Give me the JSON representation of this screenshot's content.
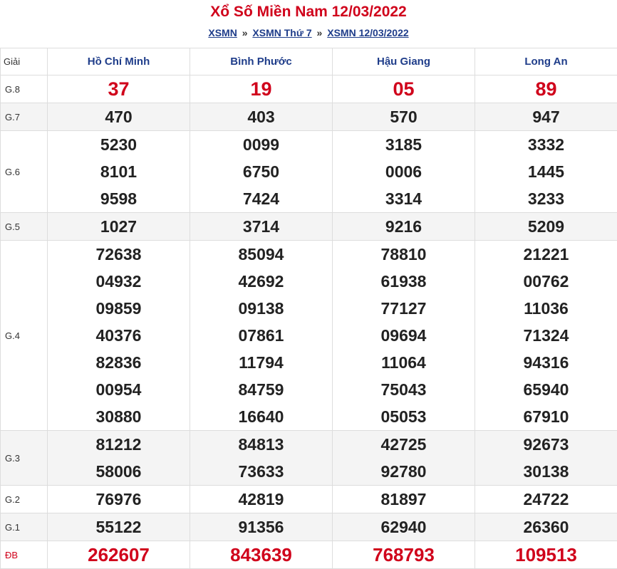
{
  "title": "Xổ Số Miền Nam 12/03/2022",
  "breadcrumb": {
    "link1": "XSMN",
    "sep1": "»",
    "link2": "XSMN Thứ 7",
    "sep2": "»",
    "link3": "XSMN 12/03/2022"
  },
  "table": {
    "header_label": "Giải",
    "provinces": [
      "Hồ Chí Minh",
      "Bình Phước",
      "Hậu Giang",
      "Long An"
    ],
    "colors": {
      "red": "#d0021b",
      "link_blue": "#1f3d8a"
    },
    "prizes": [
      {
        "label": "G.8",
        "style": "big",
        "alt": false,
        "values": [
          [
            "37"
          ],
          [
            "19"
          ],
          [
            "05"
          ],
          [
            "89"
          ]
        ]
      },
      {
        "label": "G.7",
        "style": "normal",
        "alt": true,
        "values": [
          [
            "470"
          ],
          [
            "403"
          ],
          [
            "570"
          ],
          [
            "947"
          ]
        ]
      },
      {
        "label": "G.6",
        "style": "normal",
        "alt": false,
        "values": [
          [
            "5230",
            "8101",
            "9598"
          ],
          [
            "0099",
            "6750",
            "7424"
          ],
          [
            "3185",
            "0006",
            "3314"
          ],
          [
            "3332",
            "1445",
            "3233"
          ]
        ]
      },
      {
        "label": "G.5",
        "style": "normal",
        "alt": true,
        "values": [
          [
            "1027"
          ],
          [
            "3714"
          ],
          [
            "9216"
          ],
          [
            "5209"
          ]
        ]
      },
      {
        "label": "G.4",
        "style": "normal",
        "alt": false,
        "values": [
          [
            "72638",
            "04932",
            "09859",
            "40376",
            "82836",
            "00954",
            "30880"
          ],
          [
            "85094",
            "42692",
            "09138",
            "07861",
            "11794",
            "84759",
            "16640"
          ],
          [
            "78810",
            "61938",
            "77127",
            "09694",
            "11064",
            "75043",
            "05053"
          ],
          [
            "21221",
            "00762",
            "11036",
            "71324",
            "94316",
            "65940",
            "67910"
          ]
        ]
      },
      {
        "label": "G.3",
        "style": "normal",
        "alt": true,
        "values": [
          [
            "81212",
            "58006"
          ],
          [
            "84813",
            "73633"
          ],
          [
            "42725",
            "92780"
          ],
          [
            "92673",
            "30138"
          ]
        ]
      },
      {
        "label": "G.2",
        "style": "normal",
        "alt": false,
        "values": [
          [
            "76976"
          ],
          [
            "42819"
          ],
          [
            "81897"
          ],
          [
            "24722"
          ]
        ]
      },
      {
        "label": "G.1",
        "style": "normal",
        "alt": true,
        "values": [
          [
            "55122"
          ],
          [
            "91356"
          ],
          [
            "62940"
          ],
          [
            "26360"
          ]
        ]
      },
      {
        "label": "ĐB",
        "style": "db",
        "alt": false,
        "values": [
          [
            "262607"
          ],
          [
            "843639"
          ],
          [
            "768793"
          ],
          [
            "109513"
          ]
        ]
      }
    ]
  }
}
